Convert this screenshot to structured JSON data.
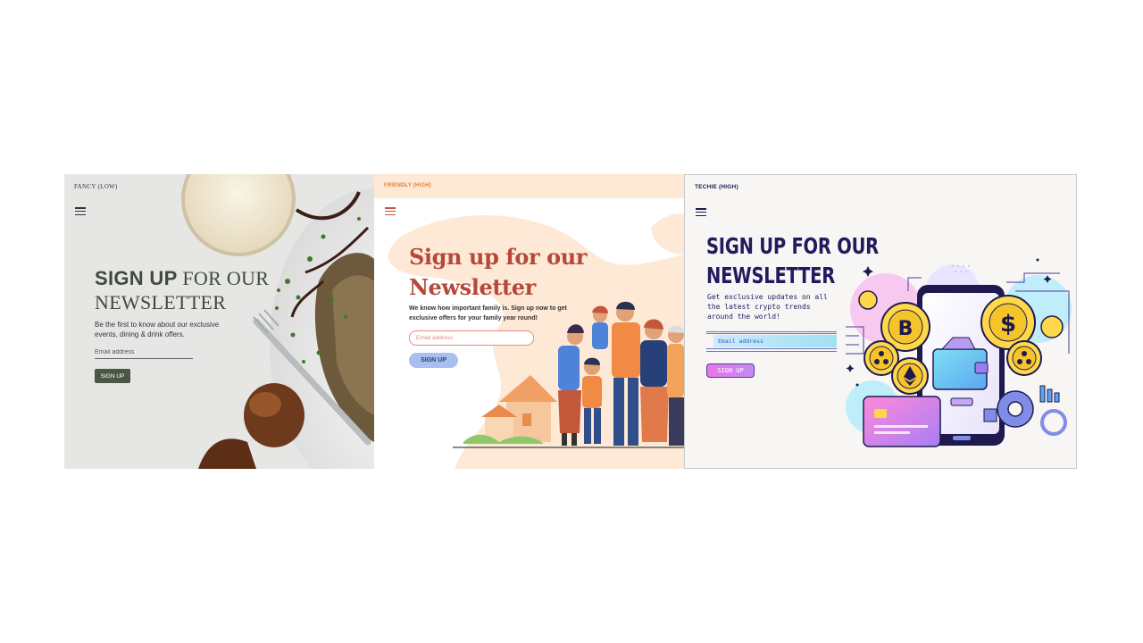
{
  "panels": {
    "fancy": {
      "tag": "FANCY (LOW)",
      "title_bold": "SIGN UP",
      "title_rest": "FOR OUR",
      "title_line2": "NEWSLETTER",
      "description": "Be the first to know about our exclusive events, dining & drink offers.",
      "email_placeholder": "Email address",
      "button_label": "SIGN UP",
      "accent": "#4b5647"
    },
    "friendly": {
      "tag": "FRIENDLY (HIGH)",
      "title_line1": "Sign up for our",
      "title_line2": "Newsletter",
      "description": "We know how important family is. Sign up now to get exclusive offers for your family year round!",
      "email_placeholder": "Email address",
      "button_label": "SIGN UP",
      "accent": "#b5483a",
      "button_color": "#a9bff0"
    },
    "techie": {
      "tag": "TECHIE (HIGH)",
      "title_line1": "SIGN UP FOR OUR",
      "title_line2": "NEWSLETTER",
      "description": "Get exclusive updates on all the latest crypto trends around the world!",
      "email_placeholder": "Email address",
      "button_label": "SIGN UP",
      "accent": "#221a5e",
      "button_color": "#e777e9"
    }
  },
  "icons": [
    "menu-icon",
    "bitcoin-icon",
    "dollar-icon",
    "ethereum-icon",
    "ripple-icon",
    "wallet-icon",
    "credit-card-icon",
    "gear-icon"
  ]
}
